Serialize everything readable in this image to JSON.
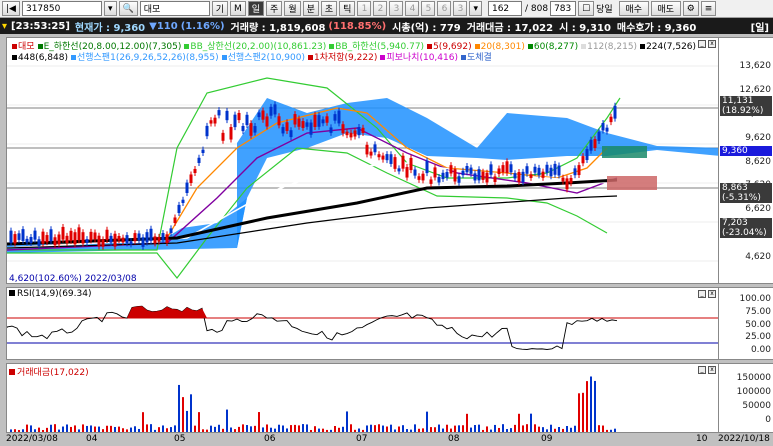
{
  "toolbar": {
    "code": "317850",
    "name": "대모",
    "period_buttons": [
      "기",
      "M",
      "일",
      "주",
      "월",
      "분",
      "초",
      "틱"
    ],
    "selected_period": "일",
    "number_buttons": [
      "1",
      "2",
      "3",
      "4",
      "5",
      "6",
      "3"
    ],
    "count_value": "162",
    "total_count": "/ 808",
    "page_value": "783",
    "today_label": "당일",
    "buy_label": "매수",
    "sell_label": "매도",
    "settings_label": "⚙",
    "menu_label": "≡"
  },
  "info": {
    "time": "[23:53:25]",
    "name_label": "현재가 : 9,360",
    "change": "▼110",
    "pct": "(1.16%)",
    "volume": "거래량 : 1,819,608",
    "volume_pct": "(118.85%)",
    "mktcap": "시총(억) : 779",
    "amount": "거래대금 : 17,022",
    "open": "시 : 9,310",
    "bid": "매수호가 : 9,360",
    "tab": "[일]"
  },
  "price_panel": {
    "legend_row1": [
      {
        "text": "대모",
        "color": "#cc0000"
      },
      {
        "text": "E_하한선(20,8.00,12.00)(7,305)",
        "color": "#007700"
      },
      {
        "text": "BB_상한선(20,2.00)(10,861.23)",
        "color": "#33cc33"
      },
      {
        "text": "BB_하한선(5,940.77)",
        "color": "#33cc33"
      },
      {
        "text": "5(9,692)",
        "color": "#cc0000"
      },
      {
        "text": "20(8,301)",
        "color": "#ff8800"
      },
      {
        "text": "60(8,277)",
        "color": "#008800"
      },
      {
        "text": "112(8,215)",
        "color": "#dddddd"
      },
      {
        "text": "224(7,526)",
        "color": "#000000"
      }
    ],
    "legend_row2": [
      {
        "text": "448(6,848)",
        "color": "#000000"
      },
      {
        "text": "선행스팬1(26,9,26,52,26)(8,955)",
        "color": "#3399ff"
      },
      {
        "text": "선행스팬2(10,900)",
        "color": "#3399ff"
      },
      {
        "text": "1차저항(9,222)",
        "color": "#cc0000"
      },
      {
        "text": "피보나치(10,416)",
        "color": "#cc00cc"
      },
      {
        "text": "도체결",
        "color": "#3366cc"
      }
    ],
    "low_label": "4,620(102.60%) 2022/03/08",
    "y_ticks": [
      "13,620",
      "12,620",
      "10,620",
      "9,620",
      "8,620",
      "7,620",
      "6,620",
      "5,620",
      "4,620"
    ],
    "flags": [
      {
        "text": "11,131",
        "sub": "(18.92%)",
        "color": "#3a3a3a"
      },
      {
        "text": "9,360",
        "sub": "",
        "color": "#1a1adc"
      },
      {
        "text": "8,863",
        "sub": "(-5.31%)",
        "color": "#3a3a3a"
      },
      {
        "text": "7,203",
        "sub": "(-23.04%)",
        "color": "#3a3a3a"
      }
    ],
    "chart_data": {
      "type": "candlestick",
      "y_range": [
        4620,
        13620
      ],
      "last_close": 9360,
      "high": 11131,
      "low": 4620
    }
  },
  "rsi_panel": {
    "title": "RSI(14,9)(69.34)",
    "y_ticks": [
      "100.00",
      "75.00",
      "50.00",
      "25.00",
      "0.00"
    ],
    "chart_data": {
      "type": "line",
      "levels": [
        70,
        30
      ],
      "last": 69.34
    }
  },
  "amount_panel": {
    "title": "거래대금(17,022)",
    "y_ticks": [
      "150000",
      "100000",
      "50000",
      "0"
    ]
  },
  "x_axis": {
    "labels": [
      "2022/03/08",
      "04",
      "05",
      "06",
      "07",
      "08",
      "09",
      "10",
      "2022/10/18"
    ]
  }
}
